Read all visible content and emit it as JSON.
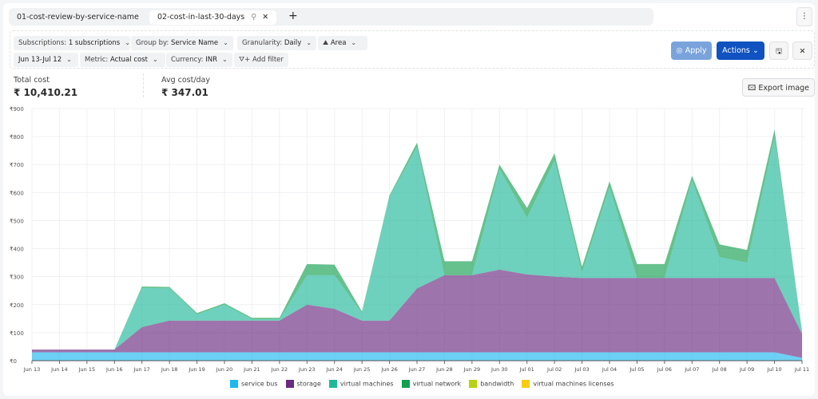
{
  "tabs": {
    "items": [
      {
        "label": "01-cost-review-by-service-name"
      },
      {
        "label": "02-cost-in-last-30-days"
      }
    ],
    "pin_icon": "pin-icon",
    "close_icon": "close-icon",
    "add": "+"
  },
  "menu": {
    "icon": "kebab-icon",
    "label": "⋮"
  },
  "filters": [
    {
      "key": "Subscriptions: ",
      "value": "1 subscriptions"
    },
    {
      "key": "Group by: ",
      "value": "Service Name"
    },
    {
      "key": "Granularity: ",
      "value": "Daily"
    },
    {
      "key": "",
      "value": "Area"
    },
    {
      "key": "",
      "value": "Jun 13-Jul 12"
    },
    {
      "key": "Metric: ",
      "value": "Actual cost"
    },
    {
      "key": "Currency: ",
      "value": "INR"
    }
  ],
  "add_filter": "Add filter",
  "buttons": {
    "apply": "Apply",
    "actions": "Actions",
    "export": "Export image"
  },
  "colors": {
    "apply": "#7aa3dc",
    "actions": "#0f52c0"
  },
  "stats": {
    "total_label": "Total cost",
    "total_value": "₹ 10,410.21",
    "avg_label": "Avg cost/day",
    "avg_value": "₹ 347.01"
  },
  "chart_data": {
    "type": "area",
    "stacked": true,
    "grid": true,
    "legend": "bottom",
    "ylim": [
      0,
      900
    ],
    "yticks": [
      "₹0",
      "₹100",
      "₹200",
      "₹300",
      "₹400",
      "₹500",
      "₹600",
      "₹700",
      "₹800",
      "₹900"
    ],
    "categories": [
      "Jun 13",
      "Jun 14",
      "Jun 15",
      "Jun 16",
      "Jun 17",
      "Jun 18",
      "Jun 19",
      "Jun 20",
      "Jun 21",
      "Jun 22",
      "Jun 23",
      "Jun 24",
      "Jun 25",
      "Jun 26",
      "Jun 27",
      "Jun 28",
      "Jun 29",
      "Jun 30",
      "Jul 01",
      "Jul 02",
      "Jul 03",
      "Jul 04",
      "Jul 05",
      "Jul 06",
      "Jul 07",
      "Jul 08",
      "Jul 09",
      "Jul 10",
      "Jul 11"
    ],
    "series": [
      {
        "name": "service bus",
        "color": "#1fb7f0",
        "values": [
          30,
          30,
          30,
          30,
          30,
          30,
          30,
          30,
          30,
          30,
          30,
          30,
          30,
          30,
          30,
          30,
          30,
          30,
          30,
          30,
          30,
          30,
          30,
          30,
          30,
          30,
          30,
          30,
          10
        ]
      },
      {
        "name": "storage",
        "color": "#6a2a80",
        "values": [
          10,
          10,
          10,
          10,
          90,
          113,
          113,
          113,
          113,
          113,
          170,
          155,
          113,
          113,
          228,
          275,
          275,
          295,
          278,
          270,
          265,
          265,
          265,
          265,
          265,
          265,
          265,
          265,
          85
        ]
      },
      {
        "name": "virtual machines",
        "color": "#20b89a",
        "values": [
          0,
          0,
          0,
          0,
          140,
          115,
          22,
          57,
          5,
          5,
          105,
          120,
          27,
          442,
          505,
          0,
          0,
          360,
          202,
          415,
          20,
          325,
          0,
          0,
          350,
          75,
          55,
          505,
          10
        ]
      },
      {
        "name": "virtual network",
        "color": "#14a050",
        "values": [
          0,
          0,
          0,
          0,
          5,
          5,
          5,
          5,
          5,
          5,
          40,
          38,
          5,
          5,
          15,
          50,
          50,
          15,
          35,
          25,
          20,
          20,
          50,
          50,
          15,
          45,
          45,
          25,
          0
        ]
      },
      {
        "name": "bandwidth",
        "color": "#b5d30e",
        "values": [
          0,
          0,
          0,
          0,
          0,
          0,
          0,
          0,
          0,
          0,
          0,
          0,
          0,
          0,
          0,
          0,
          0,
          0,
          0,
          0,
          0,
          0,
          0,
          0,
          0,
          0,
          0,
          0,
          0
        ]
      },
      {
        "name": "virtual machines licenses",
        "color": "#f8cc10",
        "values": [
          0,
          0,
          0,
          0,
          0,
          0,
          0,
          0,
          0,
          0,
          0,
          0,
          0,
          0,
          0,
          0,
          0,
          0,
          0,
          0,
          0,
          0,
          0,
          0,
          0,
          0,
          0,
          0,
          0
        ]
      }
    ]
  }
}
